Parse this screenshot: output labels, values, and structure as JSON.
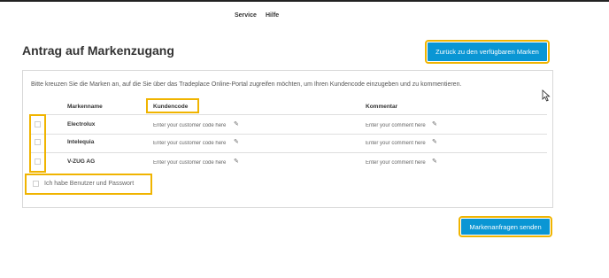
{
  "nav": {
    "service": "Service",
    "hilfe": "Hilfe"
  },
  "page": {
    "title": "Antrag auf Markenzugang"
  },
  "buttons": {
    "back": "Zurück zu den verfügbaren Marken",
    "send": "Markenanfragen senden"
  },
  "panel": {
    "intro": "Bitte kreuzen Sie die Marken an, auf die Sie über das Tradeplace Online-Portal zugreifen möchten, um Ihren Kundencode einzugeben und zu kommentieren.",
    "headers": {
      "brand": "Markenname",
      "code": "Kundencode",
      "comment": "Kommentar"
    },
    "rows": [
      {
        "brand": "Electrolux",
        "code_placeholder": "Enter your customer code here",
        "comment_placeholder": "Enter your comment here"
      },
      {
        "brand": "Intelequia",
        "code_placeholder": "Enter your customer code here",
        "comment_placeholder": "Enter your comment here"
      },
      {
        "brand": "V-ZUG AG",
        "code_placeholder": "Enter your customer code here",
        "comment_placeholder": "Enter your comment here"
      }
    ],
    "credentials_label": "Ich habe Benutzer und Passwort"
  },
  "colors": {
    "accent": "#0a96d4",
    "highlight": "#f0b400"
  },
  "icons": {
    "edit": "pencil-icon",
    "cursor": "mouse-pointer-icon"
  }
}
